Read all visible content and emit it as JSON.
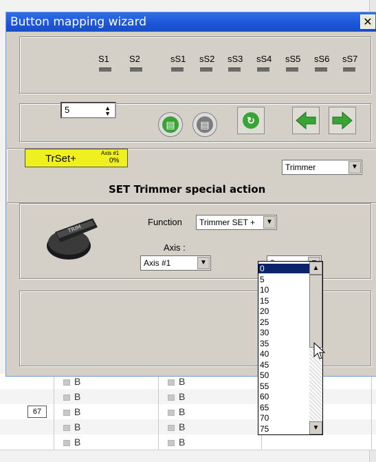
{
  "window": {
    "title": "Button mapping wizard",
    "close_label": "✕"
  },
  "status_leds": {
    "labels": [
      "S1",
      "S2",
      "sS1",
      "sS2",
      "sS3",
      "sS4",
      "sS5",
      "sS6",
      "sS7"
    ]
  },
  "toolbar": {
    "spinner_value": "5",
    "icons": [
      "copy-icon",
      "paste-icon",
      "refresh-icon",
      "arrow-left-icon",
      "arrow-right-icon"
    ]
  },
  "action_button": {
    "label": "TrSet+",
    "axis_label": "Axis #1",
    "axis_value": "0%"
  },
  "type_select": {
    "value": "Trimmer"
  },
  "section_title": "SET Trimmer special action",
  "function": {
    "label": "Function",
    "value": "Trimmer SET +"
  },
  "axis": {
    "label": "Axis :",
    "value": "Axis #1"
  },
  "amount_select": {
    "value": "0",
    "options": [
      "0",
      "5",
      "10",
      "15",
      "20",
      "25",
      "30",
      "35",
      "40",
      "45",
      "50",
      "55",
      "60",
      "65",
      "70",
      "75"
    ]
  },
  "background_table": {
    "rows": [
      {
        "num": "",
        "col1": "B",
        "col2": "B"
      },
      {
        "num": "",
        "col1": "B",
        "col2": "B"
      },
      {
        "num": "67",
        "col1": "B",
        "col2": "B"
      },
      {
        "num": "",
        "col1": "B",
        "col2": "B"
      },
      {
        "num": "",
        "col1": "B",
        "col2": "B"
      }
    ]
  },
  "colors": {
    "title_bar": "#1d55d6",
    "dialog_bg": "#d4d0c8",
    "highlight": "#0a246a",
    "action_button": "#f0f01e",
    "green_button": "#3aa335"
  }
}
